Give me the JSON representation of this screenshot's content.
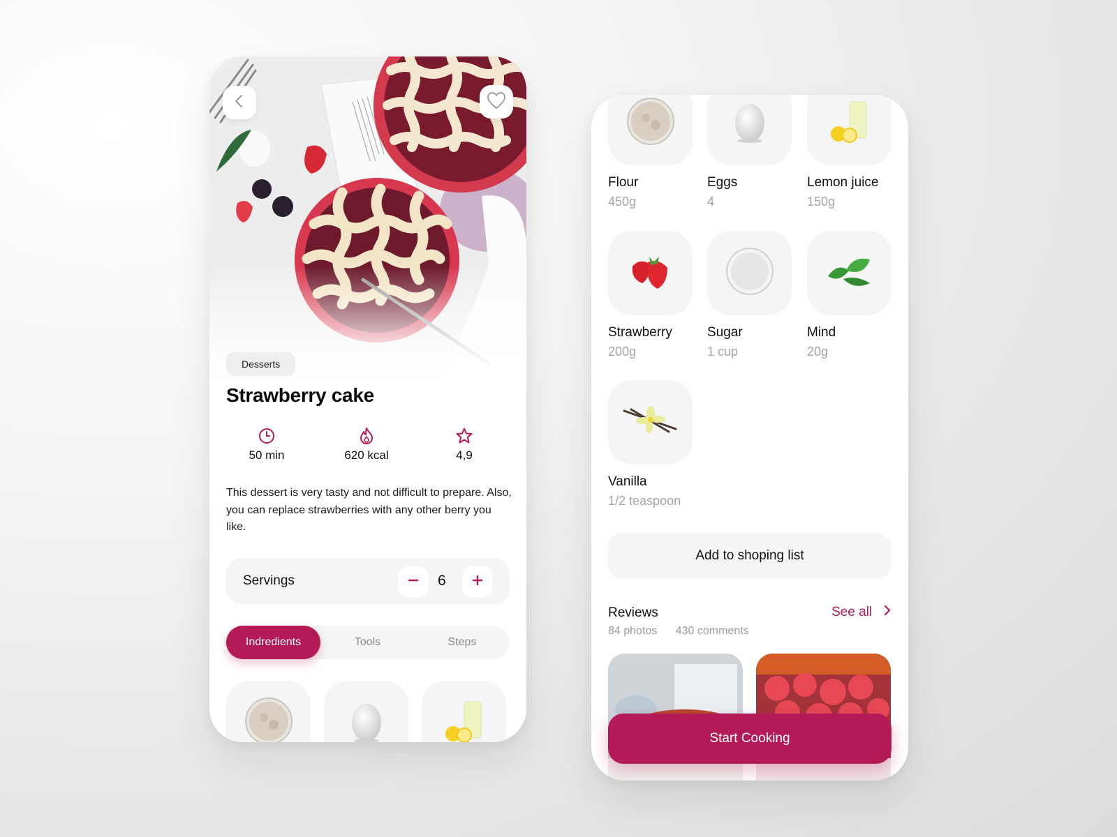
{
  "theme": {
    "accent": "#b31a56",
    "tile_bg": "#f5f5f5",
    "muted_text": "#a5a5a5"
  },
  "recipe": {
    "category": "Desserts",
    "title": "Strawberry cake",
    "stats": [
      {
        "icon": "clock-icon",
        "value": "50 min"
      },
      {
        "icon": "flame-icon",
        "value": "620 kcal"
      },
      {
        "icon": "star-icon",
        "value": "4,9"
      }
    ],
    "description": "This dessert is very tasty and not difficult to prepare. Also, you can replace strawberries with any other berry you like.",
    "servings": {
      "label": "Servings",
      "count": "6",
      "minus_icon": "minus-icon",
      "plus_icon": "plus-icon"
    },
    "tabs": [
      {
        "label": "Indredients",
        "active": true
      },
      {
        "label": "Tools",
        "active": false
      },
      {
        "label": "Steps",
        "active": false
      }
    ]
  },
  "header": {
    "back_icon": "chevron-left-icon",
    "favorite_icon": "heart-icon"
  },
  "ingredients": [
    {
      "name": "Flour",
      "qty": "450g",
      "image": "flour-bowl"
    },
    {
      "name": "Eggs",
      "qty": "4",
      "image": "egg"
    },
    {
      "name": "Lemon juice",
      "qty": "150g",
      "image": "lemon-juice-glass"
    },
    {
      "name": "Strawberry",
      "qty": "200g",
      "image": "strawberry"
    },
    {
      "name": "Sugar",
      "qty": "1 cup",
      "image": "sugar-bowl"
    },
    {
      "name": "Mind",
      "qty": "20g",
      "image": "mint-leaves"
    },
    {
      "name": "Vanilla",
      "qty": "1/2 teaspoon",
      "image": "vanilla-flower"
    }
  ],
  "actions": {
    "add_to_list": "Add to shoping list",
    "start_cooking": "Start Cooking"
  },
  "reviews": {
    "title": "Reviews",
    "photos": "84 photos",
    "comments": "430 comments",
    "see_all": "See all"
  }
}
